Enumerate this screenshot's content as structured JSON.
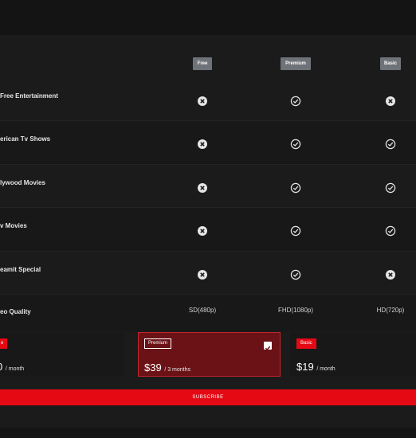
{
  "plans": [
    {
      "name": "Free"
    },
    {
      "name": "Premium"
    },
    {
      "name": "Basic"
    }
  ],
  "features": [
    {
      "label": "Free Entertainment",
      "values": [
        "no",
        "yes",
        "no"
      ]
    },
    {
      "label": "erican Tv Shows",
      "values": [
        "no",
        "yes",
        "yes"
      ]
    },
    {
      "label": "lywood Movies",
      "values": [
        "no",
        "yes",
        "yes"
      ]
    },
    {
      "label": "v Movies",
      "values": [
        "no",
        "yes",
        "yes"
      ]
    },
    {
      "label": "eamit Special",
      "values": [
        "no",
        "yes",
        "no"
      ]
    }
  ],
  "video_quality": {
    "label": "eo Quality",
    "values": [
      "SD(480p)",
      "FHD(1080p)",
      "HD(720p)"
    ]
  },
  "cards": [
    {
      "tag": "e",
      "price": "0",
      "per": "/ month",
      "selected": false
    },
    {
      "tag": "Premium",
      "price": "$39",
      "per": "/ 3 months",
      "selected": true
    },
    {
      "tag": "Basic",
      "price": "$19",
      "per": "/ month",
      "selected": false
    }
  ],
  "subscribe_label": "SUBSCRIBE",
  "colors": {
    "accent": "#e50914",
    "selected_card": "#6b1217",
    "badge": "#6e737a"
  },
  "icons": {
    "yes": "check-circle-icon",
    "no": "x-circle-icon"
  }
}
